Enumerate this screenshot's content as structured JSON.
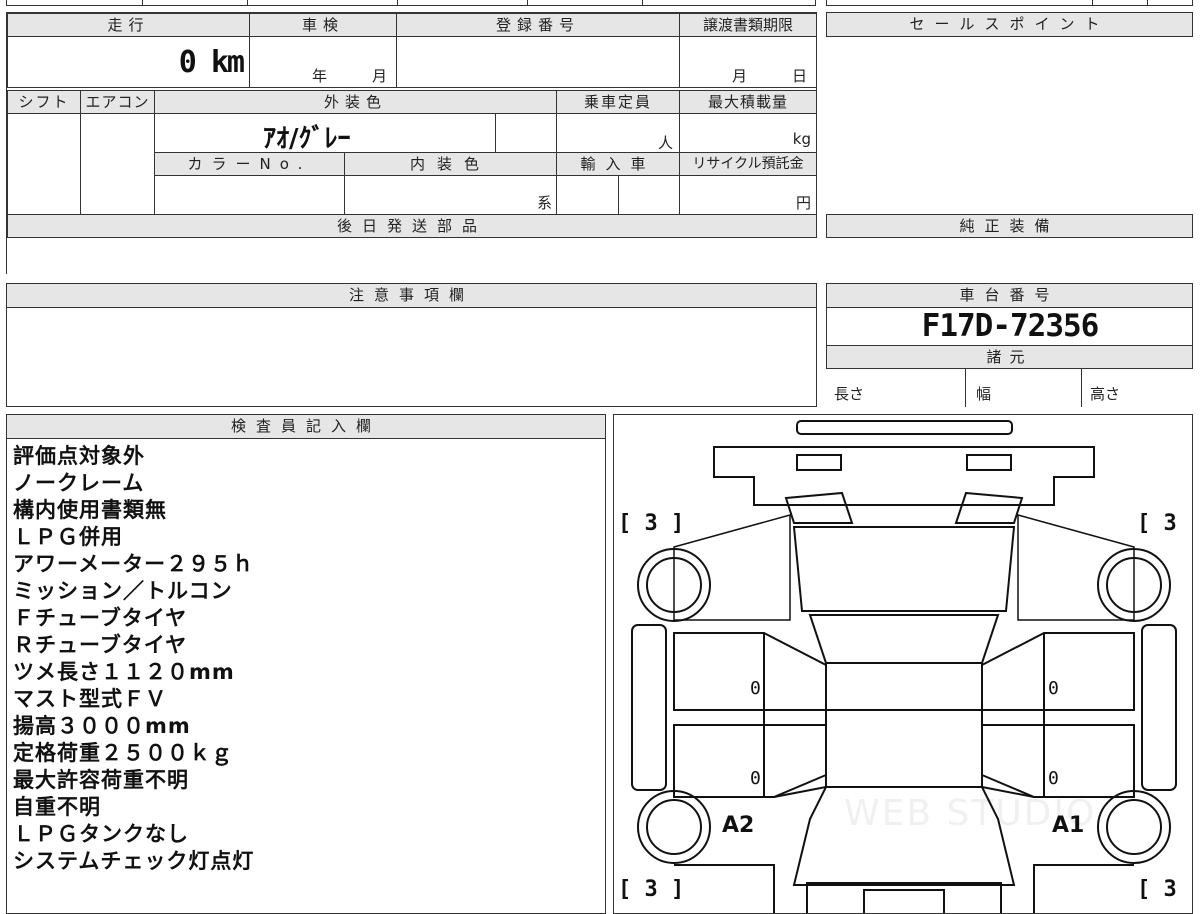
{
  "headers": {
    "mileage": "走行",
    "inspection": "車検",
    "registration_no": "登録番号",
    "transfer_deadline": "譲渡書類期限",
    "sales_point": "セールスポイント",
    "shift": "シフト",
    "aircon": "エアコン",
    "exterior_color": "外装色",
    "capacity": "乗車定員",
    "max_load": "最大積載量",
    "color_no": "カラーNo.",
    "interior_color": "内装色",
    "import": "輸入車",
    "recycle": "リサイクル預託金",
    "later_parts": "後日発送部品",
    "genuine_equipment": "純正装備",
    "notes": "注意事項欄",
    "chassis_no": "車台番号",
    "specs": "諸元",
    "inspector": "検査員記入欄"
  },
  "values": {
    "mileage": "0 km",
    "inspection_year_unit": "年",
    "inspection_month_unit": "月",
    "transfer_month_unit": "月",
    "transfer_day_unit": "日",
    "exterior_color": "ｱｵ/ｸﾞﾚｰ",
    "capacity_unit": "人",
    "max_load_unit": "kg",
    "interior_color_unit": "系",
    "recycle_unit": "円",
    "chassis_no": "F17D-72356",
    "spec_length": "長さ",
    "spec_width": "幅",
    "spec_height": "高さ"
  },
  "inspector_notes": [
    "評価点対象外",
    "ノークレーム",
    "構内使用書類無",
    "ＬＰＧ併用",
    "アワーメーター２９５ｈ",
    "ミッション／トルコン",
    "Ｆチューブタイヤ",
    "Ｒチューブタイヤ",
    "ツメ長さ１１２０mm",
    "マスト型式ＦＶ",
    "揚高３０００mm",
    "定格荷重２５００ｋｇ",
    "最大許容荷重不明",
    "自重不明",
    "ＬＰＧタンクなし",
    "システムチェック灯点灯"
  ],
  "diagram": {
    "severity_top_left": "[ 3 ]",
    "severity_top_right": "[ 3 ]",
    "severity_bottom_left": "[ 3 ]",
    "severity_bottom_right": "[ 3 ]",
    "panel_left_upper": "0",
    "panel_right_upper": "0",
    "panel_left_lower": "0",
    "panel_right_lower": "0",
    "wheel_left_label": "A2",
    "wheel_right_label": "A1",
    "watermark": "WEB STUDIO"
  }
}
